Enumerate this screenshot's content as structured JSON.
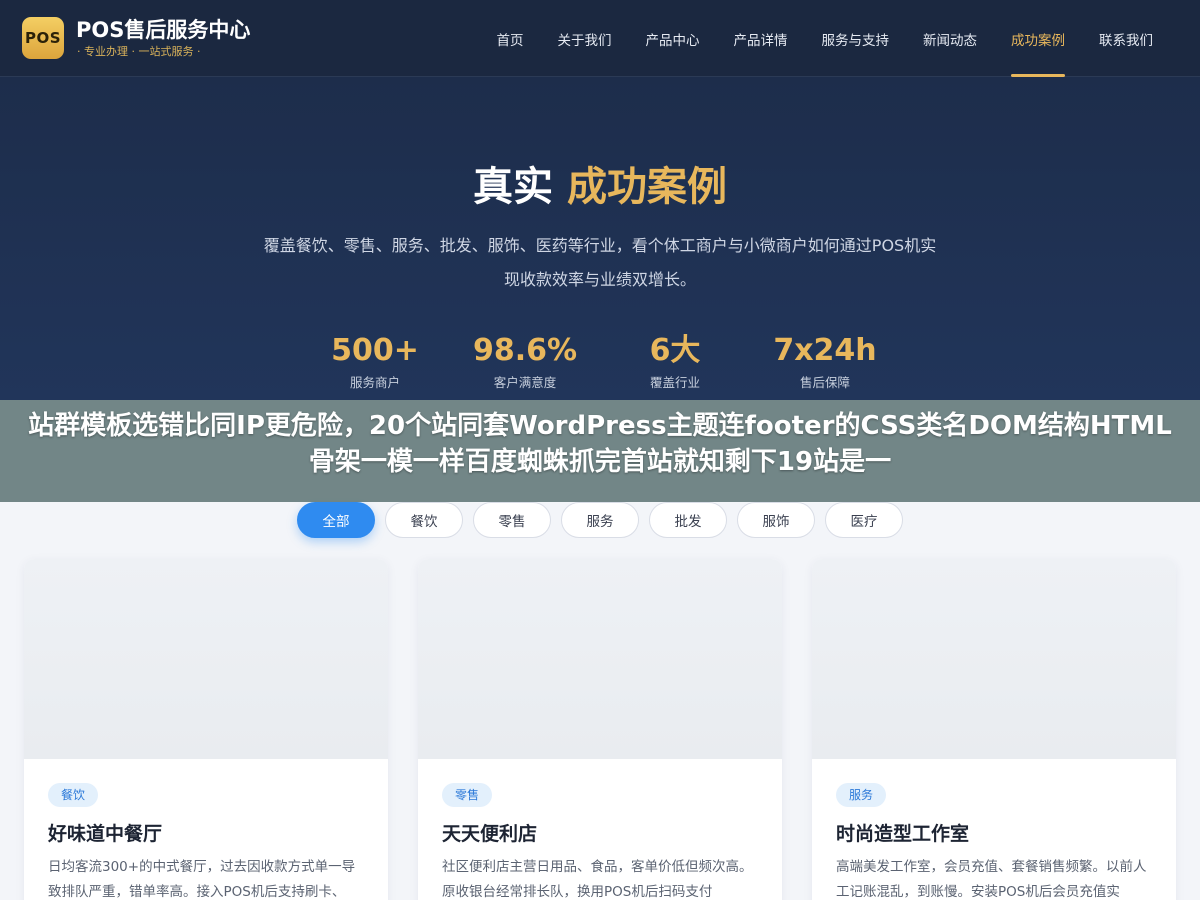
{
  "brand": {
    "logo_text": "POS",
    "title": "POS售后服务中心",
    "subtitle": "· 专业办理 · 一站式服务 ·"
  },
  "nav": {
    "items": [
      {
        "label": "首页",
        "active": false
      },
      {
        "label": "关于我们",
        "active": false
      },
      {
        "label": "产品中心",
        "active": false
      },
      {
        "label": "产品详情",
        "active": false
      },
      {
        "label": "服务与支持",
        "active": false
      },
      {
        "label": "新闻动态",
        "active": false
      },
      {
        "label": "成功案例",
        "active": true
      },
      {
        "label": "联系我们",
        "active": false
      }
    ]
  },
  "hero": {
    "title_plain": "真实",
    "title_accent": "成功案例",
    "description": "覆盖餐饮、零售、服务、批发、服饰、医药等行业，看个体工商户与小微商户如何通过POS机实现收款效率与业绩双增长。",
    "stats": [
      {
        "value": "500+",
        "label": "服务商户"
      },
      {
        "value": "98.6%",
        "label": "客户满意度"
      },
      {
        "value": "6大",
        "label": "覆盖行业"
      },
      {
        "value": "7x24h",
        "label": "售后保障"
      }
    ]
  },
  "overlay": {
    "text": "站群模板选错比同IP更危险，20个站同套WordPress主题连footer的CSS类名DOM结构HTML骨架一模一样百度蜘蛛抓完首站就知剩下19站是一"
  },
  "filters": [
    {
      "label": "全部",
      "active": true
    },
    {
      "label": "餐饮",
      "active": false
    },
    {
      "label": "零售",
      "active": false
    },
    {
      "label": "服务",
      "active": false
    },
    {
      "label": "批发",
      "active": false
    },
    {
      "label": "服饰",
      "active": false
    },
    {
      "label": "医疗",
      "active": false
    }
  ],
  "cases": [
    {
      "tag": "餐饮",
      "title": "好味道中餐厅",
      "description": "日均客流300+的中式餐厅，过去因收款方式单一导致排队严重，错单率高。接入POS机后支持刷卡、"
    },
    {
      "tag": "零售",
      "title": "天天便利店",
      "description": "社区便利店主营日用品、食品，客单价低但频次高。原收银台经常排长队，换用POS机后扫码支付"
    },
    {
      "tag": "服务",
      "title": "时尚造型工作室",
      "description": "高端美发工作室，会员充值、套餐销售频繁。以前人工记账混乱，到账慢。安装POS机后会员充值实"
    }
  ],
  "colors": {
    "header_bg": "#1b2840",
    "hero_bg": "#1d2d4b",
    "accent_gold": "#e8b75c",
    "primary_blue": "#2f8bf0"
  }
}
